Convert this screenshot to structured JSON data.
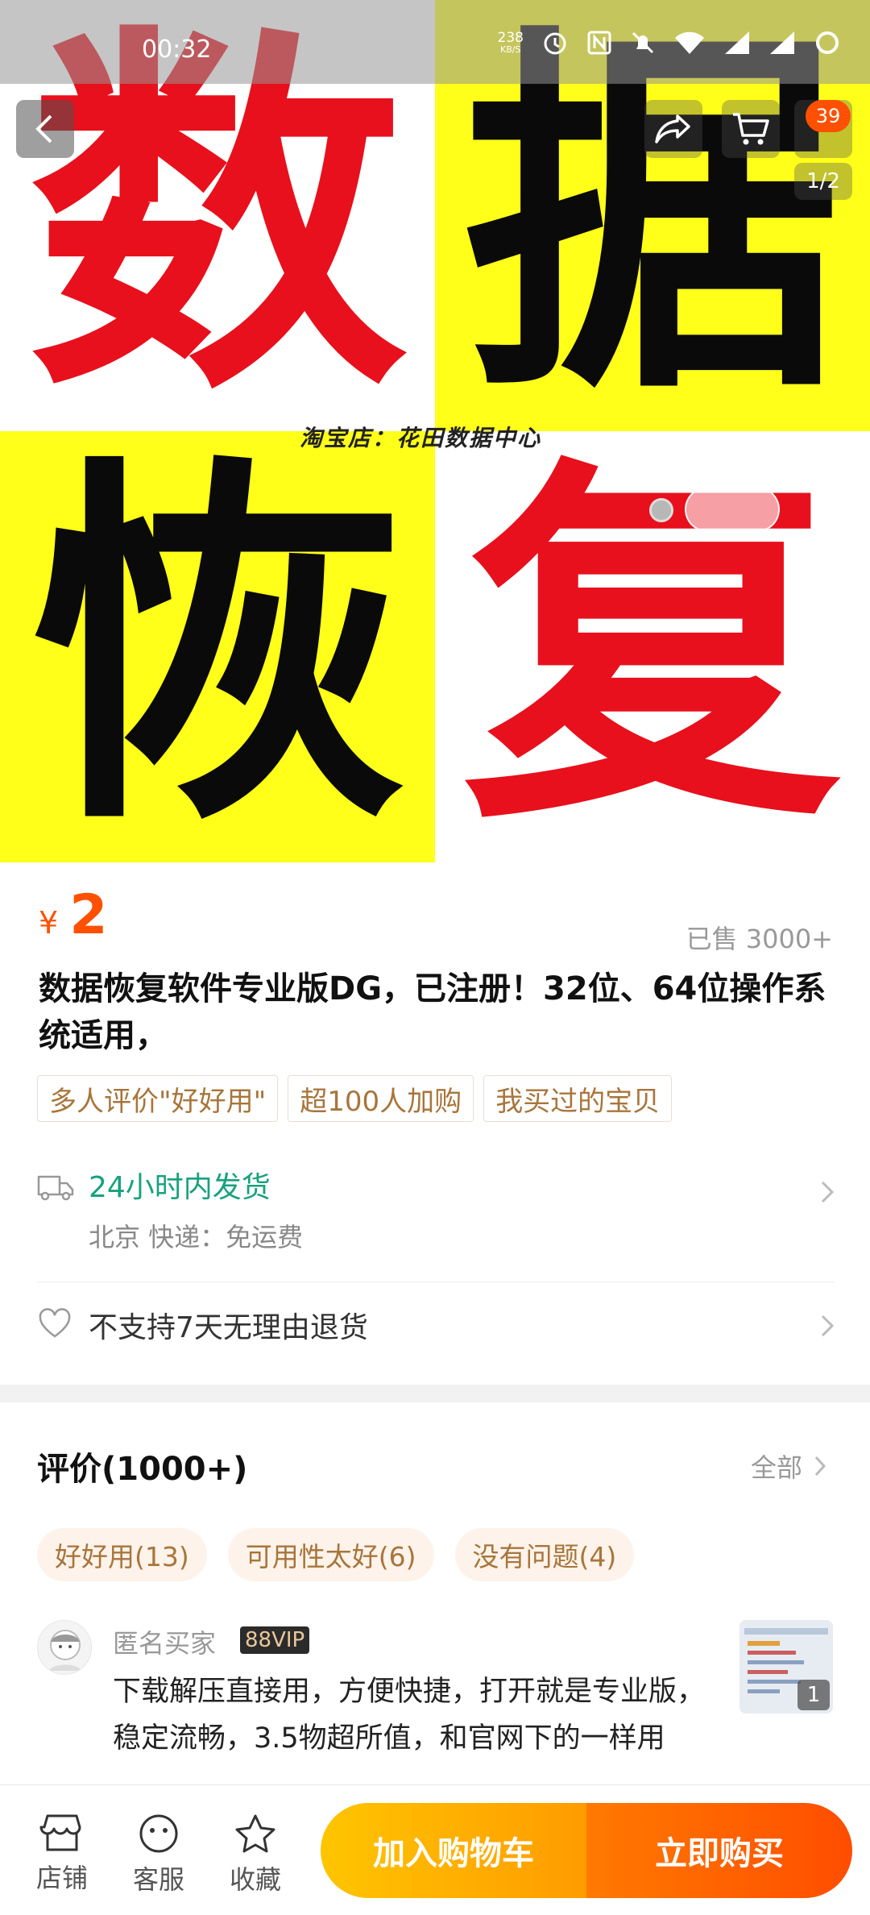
{
  "status_bar": {
    "time": "00:32",
    "net_speed_value": "238",
    "net_speed_unit": "KB/S",
    "icons": [
      "alarm-icon",
      "nfc-icon",
      "bell-off-icon",
      "wifi-icon",
      "signal-icon",
      "signal-icon",
      "battery-ring-icon"
    ]
  },
  "hero": {
    "chars": [
      "数",
      "据",
      "恢",
      "复"
    ],
    "watermark": "淘宝店：花田数据中心",
    "counter": "1/2",
    "cart_badge": "39"
  },
  "product": {
    "price_symbol": "¥",
    "price": "2",
    "sold": "已售 3000+",
    "title": "数据恢复软件专业版DG，已注册！32位、64位操作系统适用，",
    "tags": [
      "多人评价\"好好用\"",
      "超100人加购",
      "我买过的宝贝"
    ]
  },
  "shipping": {
    "title": "24小时内发货",
    "sub": "北京  快递：免运费"
  },
  "returns": {
    "text": "不支持7天无理由退货"
  },
  "reviews": {
    "header": "评价(1000+)",
    "all_label": "全部",
    "tags": [
      "好好用(13)",
      "可用性太好(6)",
      "没有问题(4)"
    ],
    "first": {
      "reviewer": "匿名买家",
      "vip": "88VIP",
      "text": "下载解压直接用，方便快捷，打开就是专业版，稳定流畅，3.5物超所值，和官网下的一样用",
      "thumb_count": "1"
    }
  },
  "bottom_bar": {
    "shop": "店铺",
    "service": "客服",
    "favorite": "收藏",
    "add_cart": "加入购物车",
    "buy_now": "立即购买"
  },
  "colors": {
    "accent": "#ff5000",
    "ship_green": "#17a27e",
    "tag_brown": "#a8753b",
    "hero_yellow": "#ffff1a",
    "hero_red": "#e8101c"
  }
}
